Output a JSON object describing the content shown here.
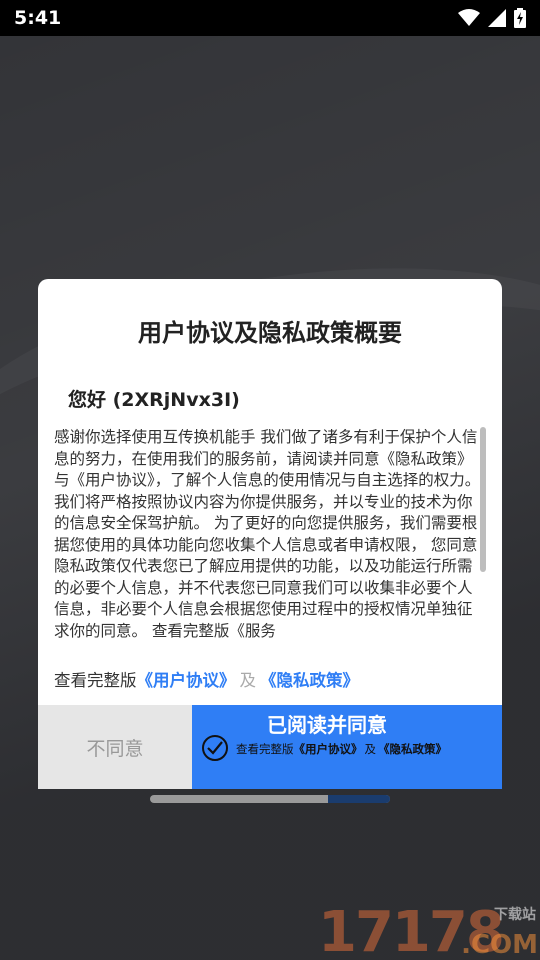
{
  "status_bar": {
    "time": "5:41",
    "icons": [
      "wifi-icon",
      "signal-icon",
      "battery-charging-icon"
    ]
  },
  "dialog": {
    "title": "用户协议及隐私政策概要",
    "greeting": "您好 (2XRjNvx3I)",
    "body": "感谢你选择使用互传换机能手 我们做了诸多有利于保护个人信息的努力，在使用我们的服务前，请阅读并同意《隐私政策》与《用户协议》，了解个人信息的使用情况与自主选择的权力。 我们将严格按照协议内容为你提供服务，并以专业的技术为你的信息安全保驾护航。 为了更好的向您提供服务，我们需要根据您使用的具体功能向您收集个人信息或者申请权限， 您同意隐私政策仅代表您已了解应用提供的功能，以及功能运行所需的必要个人信息，并不代表您已同意我们可以收集非必要个人信息，非必要个人信息会根据您使用过程中的授权情况单独征求你的同意。 查看完整版《服务",
    "links_prefix": "查看完整版",
    "user_agreement_link": "《用户协议》",
    "and": "及",
    "privacy_policy_link": "《隐私政策》",
    "disagree_label": "不同意",
    "agree_label": "已阅读并同意",
    "agree_sub_prefix": "查看完整版",
    "agree_sub_user_agreement": "《用户协议》",
    "agree_sub_and": "及",
    "agree_sub_privacy_policy": "《隐私政策》"
  },
  "watermark": {
    "digits": "17178",
    "site": "下载站",
    "suffix": ".COM"
  },
  "colors": {
    "accent": "#2f7ef5",
    "disagree_bg": "#e6e6e6",
    "backdrop": "#2f3034"
  }
}
